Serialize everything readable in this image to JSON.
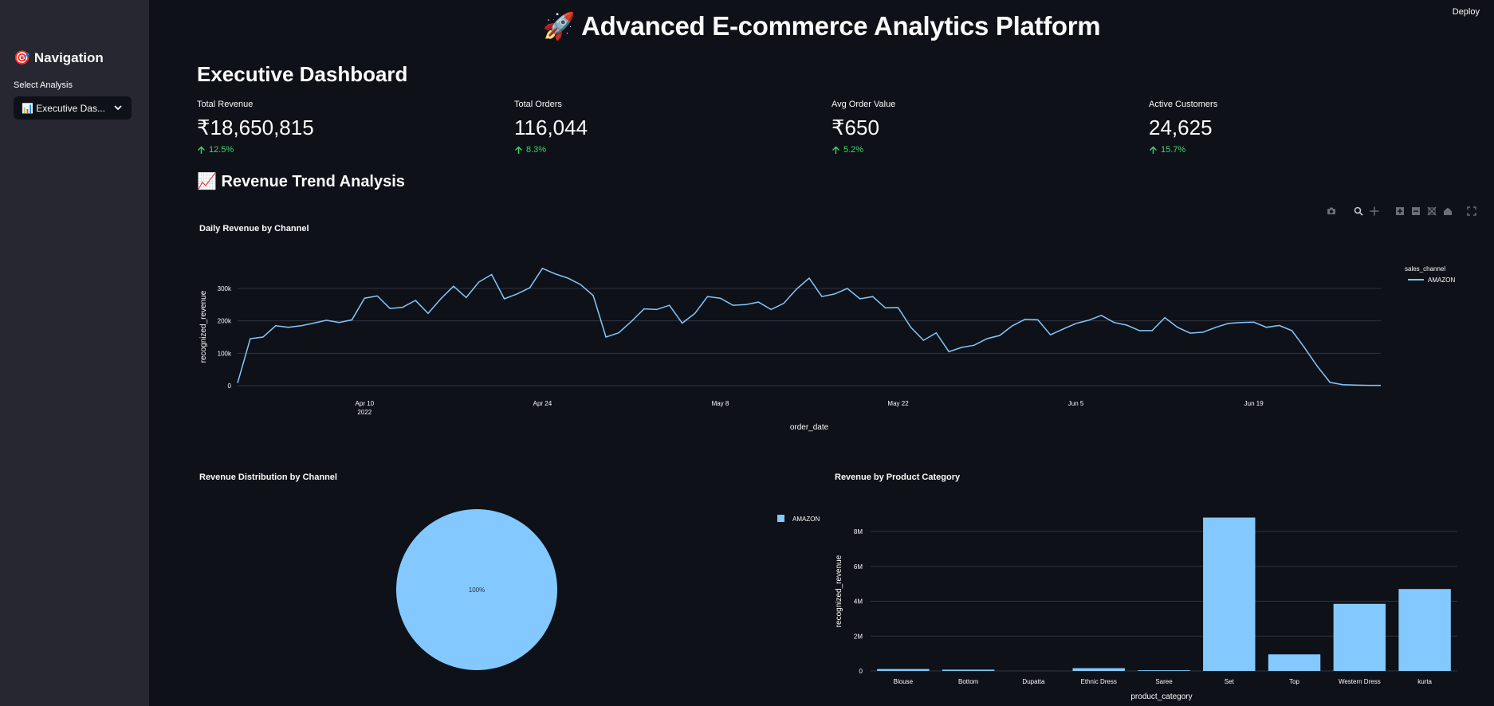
{
  "app": {
    "title": "🚀 Advanced E-commerce Analytics Platform",
    "deploy_label": "Deploy"
  },
  "sidebar": {
    "title": "🎯 Navigation",
    "select_label": "Select Analysis",
    "selected_value": "📊 Executive Das..."
  },
  "page": {
    "heading": "Executive Dashboard",
    "section_heading": "📈 Revenue Trend Analysis"
  },
  "metrics": [
    {
      "label": "Total Revenue",
      "value": "₹18,650,815",
      "delta": "12.5%"
    },
    {
      "label": "Total Orders",
      "value": "116,044",
      "delta": "8.3%"
    },
    {
      "label": "Avg Order Value",
      "value": "₹650",
      "delta": "5.2%"
    },
    {
      "label": "Active Customers",
      "value": "24,625",
      "delta": "15.7%"
    }
  ],
  "colors": {
    "series": "#83c9ff",
    "delta_positive": "#3dd56d",
    "sidebar_bg": "#262730",
    "app_bg": "#0e1117",
    "grid": "#31333f"
  },
  "chart_data": [
    {
      "type": "line",
      "title": "Daily Revenue by Channel",
      "xlabel": "order_date",
      "ylabel": "recognized_revenue",
      "x_ticks": [
        "Apr 10\n2022",
        "Apr 24",
        "May 8",
        "May 22",
        "Jun 5",
        "Jun 19"
      ],
      "y_ticks": [
        "0",
        "100k",
        "200k",
        "300k"
      ],
      "ylim": [
        0,
        340000
      ],
      "x_range": [
        "2022-03-31",
        "2022-06-29"
      ],
      "legend_title": "sales_channel",
      "legend_position": "top-right",
      "series": [
        {
          "name": "AMAZON",
          "start_date": "2022-03-31",
          "values": [
            8000,
            145000,
            150000,
            185000,
            180000,
            185000,
            193000,
            202000,
            195000,
            203000,
            270000,
            277000,
            238000,
            242000,
            263000,
            223000,
            268000,
            307000,
            272000,
            320000,
            343000,
            268000,
            283000,
            302000,
            362000,
            345000,
            332000,
            312000,
            278000,
            150000,
            163000,
            198000,
            237000,
            235000,
            248000,
            193000,
            223000,
            275000,
            270000,
            248000,
            250000,
            258000,
            235000,
            254000,
            298000,
            332000,
            275000,
            283000,
            300000,
            268000,
            275000,
            240000,
            241000,
            180000,
            140000,
            163000,
            105000,
            118000,
            125000,
            145000,
            155000,
            185000,
            205000,
            203000,
            157000,
            175000,
            192000,
            202000,
            217000,
            195000,
            187000,
            170000,
            170000,
            210000,
            180000,
            162000,
            165000,
            180000,
            192000,
            195000,
            196000,
            180000,
            186000,
            170000,
            117000,
            60000,
            10000,
            3000,
            2000,
            1000,
            1000
          ]
        }
      ]
    },
    {
      "type": "pie",
      "title": "Revenue Distribution by Channel",
      "labels": [
        "AMAZON"
      ],
      "values": [
        100
      ],
      "slice_labels": [
        "100%"
      ],
      "legend_position": "top-right"
    },
    {
      "type": "bar",
      "title": "Revenue by Product Category",
      "xlabel": "product_category",
      "ylabel": "recognized_revenue",
      "categories": [
        "Blouse",
        "Bottom",
        "Dupatta",
        "Ethnic Dress",
        "Saree",
        "Set",
        "Top",
        "Western Dress",
        "kurta"
      ],
      "values": [
        110000,
        75000,
        1000,
        160000,
        40000,
        8800000,
        950000,
        3850000,
        4700000
      ],
      "y_ticks": [
        "0",
        "2M",
        "4M",
        "6M",
        "8M"
      ],
      "ylim": [
        0,
        9200000
      ]
    }
  ]
}
